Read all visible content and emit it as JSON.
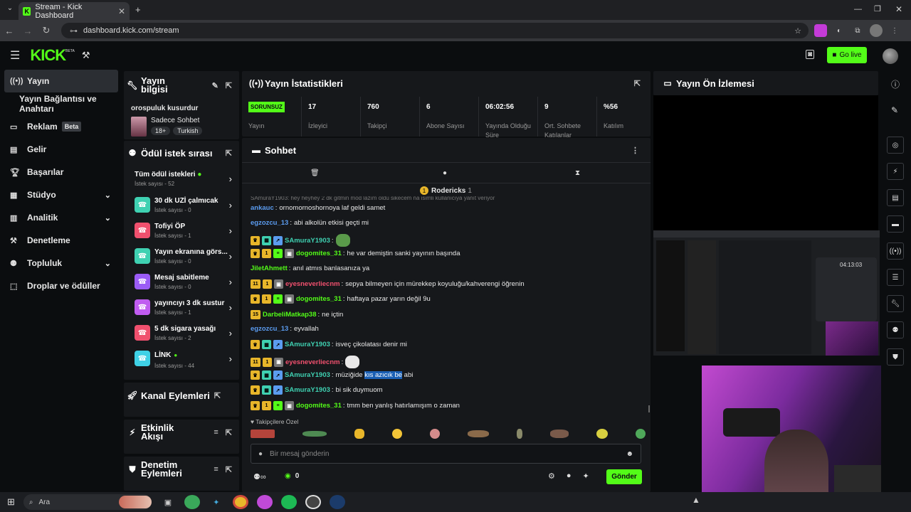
{
  "browser": {
    "tab_title": "Stream - Kick Dashboard",
    "url": "dashboard.kick.com/stream"
  },
  "app": {
    "logo": "KICK",
    "logo_beta": "BETA",
    "go_live": "Go live"
  },
  "nav": {
    "items": [
      {
        "label": "Yayın",
        "icon": "broadcast-icon"
      },
      {
        "label": "Yayın Bağlantısı ve Anahtarı"
      },
      {
        "label": "Reklam",
        "badge": "Beta",
        "icon": "ad-icon"
      },
      {
        "label": "Gelir",
        "icon": "revenue-icon"
      },
      {
        "label": "Başarılar",
        "icon": "trophy-icon"
      },
      {
        "label": "Stüdyo",
        "icon": "studio-icon"
      },
      {
        "label": "Analitik",
        "icon": "analytics-icon"
      },
      {
        "label": "Denetleme",
        "icon": "moderation-icon"
      },
      {
        "label": "Topluluk",
        "icon": "community-icon"
      },
      {
        "label": "Droplar ve ödüller",
        "icon": "drops-icon"
      }
    ]
  },
  "stream_info": {
    "title": "Yayın bilgisi",
    "stream_title": "orospuluk kusurdur",
    "category": "Sadece Sohbet",
    "tags": [
      "18+",
      "Turkish"
    ]
  },
  "rewards": {
    "title": "Ödül istek sırası",
    "all": "Tüm ödül istekleri",
    "all_count": "İstek sayısı - 52",
    "items": [
      {
        "name": "30 dk UZİ çalmıcak",
        "count": "İstek sayısı - 0",
        "color": "#3fd1b2"
      },
      {
        "name": "Tofiyi ÖP",
        "count": "İstek sayısı - 1",
        "color": "#f0506e"
      },
      {
        "name": "Yayın ekranına görs...",
        "count": "İstek sayısı - 0",
        "color": "#3fd1b2"
      },
      {
        "name": "Mesaj sabitleme",
        "count": "İstek sayısı - 0",
        "color": "#9b5cf6"
      },
      {
        "name": "yayıncıyı 3 dk sustur",
        "count": "İstek sayısı - 1",
        "color": "#c05cf0"
      },
      {
        "name": "5 dk sigara yasağı",
        "count": "İstek sayısı - 2",
        "color": "#f0506e"
      },
      {
        "name": "LİNK",
        "count": "İstek sayısı - 44",
        "color": "#3fd1e6"
      }
    ]
  },
  "channel_actions": {
    "title": "Kanal Eylemleri"
  },
  "activity": {
    "title": "Etkinlik Akışı"
  },
  "mod_actions": {
    "title": "Denetim Eylemleri"
  },
  "stats": {
    "title": "Yayın İstatistikleri",
    "items": [
      {
        "value": "SORUNSUZ",
        "label": "Yayın"
      },
      {
        "value": "17",
        "label": "İzleyici"
      },
      {
        "value": "760",
        "label": "Takipçi"
      },
      {
        "value": "6",
        "label": "Abone Sayısı"
      },
      {
        "value": "06:02:56",
        "label": "Yayında Olduğu Süre"
      },
      {
        "value": "9",
        "label": "Ort. Sohbete Katılanlar"
      },
      {
        "value": "%56",
        "label": "Katılım"
      }
    ]
  },
  "chat": {
    "title": "Sohbet",
    "pinned_user": "Rodericks",
    "pinned_count": "1",
    "faded": "SAmuraY1903: hey heyhey 2 dk gitmin mod lazım oldu sikecem na isimli kullanıcıya yanıt veriyor",
    "messages": [
      {
        "user": "ankauc",
        "color": "#5b9cf0",
        "text": "ornomornoshornoya laf geldi samet",
        "badges": []
      },
      {
        "user": "egzozcu_13",
        "color": "#5b9cf0",
        "text": "abi alkolün etkisi geçti mi",
        "badges": []
      },
      {
        "user": "SAmuraY1903",
        "color": "#3fd1b2",
        "text": "",
        "badges": [
          "crown",
          "grid",
          "arrow"
        ],
        "emote": true
      },
      {
        "user": "dogomites_31",
        "color": "#53fc18",
        "text": "he var demiştin sanki yayının başında",
        "badges": [
          "crown",
          "1",
          "green",
          "gift"
        ]
      },
      {
        "user": "JiletAhmett",
        "color": "#53fc18",
        "text": "anıl atmıs banlasanıza ya",
        "badges": []
      },
      {
        "user": "eyesneverliecnm",
        "color": "#f0506e",
        "text": "sepya bilmeyen için mürekkep koyuluğu/kahverengi öğrenin",
        "badges": [
          "11",
          "1",
          "gift"
        ]
      },
      {
        "user": "dogomites_31",
        "color": "#53fc18",
        "text": "haftaya pazar yarın değil 9u",
        "badges": [
          "crown",
          "1",
          "green",
          "gift"
        ]
      },
      {
        "user": "DarbeliMatkap38",
        "color": "#53fc18",
        "text": "ne içtin",
        "badges": [
          "15"
        ]
      },
      {
        "user": "egzozcu_13",
        "color": "#5b9cf0",
        "text": "eyvallah",
        "badges": []
      },
      {
        "user": "SAmuraY1903",
        "color": "#3fd1b2",
        "text": "isveç çikolatası denir mi",
        "badges": [
          "crown",
          "grid",
          "arrow"
        ]
      },
      {
        "user": "eyesneverliecnm",
        "color": "#f0506e",
        "text": "",
        "badges": [
          "11",
          "1",
          "gift"
        ],
        "emote": true
      },
      {
        "user": "SAmuraY1903",
        "color": "#3fd1b2",
        "text_a": "müziğide ",
        "text_hl": "kıs azıcık be",
        "text_b": " abi",
        "badges": [
          "crown",
          "grid",
          "arrow"
        ]
      },
      {
        "user": "SAmuraY1903",
        "color": "#3fd1b2",
        "text": "bi sik duymuom",
        "badges": [
          "crown",
          "grid",
          "arrow"
        ]
      },
      {
        "user": "dogomites_31",
        "color": "#53fc18",
        "text": "tmm ben yanlış hatırlamışım o zaman",
        "badges": [
          "crown",
          "1",
          "green",
          "gift"
        ]
      }
    ],
    "follower_only": "Takipçilere Özel",
    "input_placeholder": "Bir mesaj gönderin",
    "send": "Gönder",
    "viewer_count": "0"
  },
  "preview": {
    "title": "Yayın Ön İzlemesi",
    "clock": "04:13:03"
  },
  "taskbar": {
    "search": "Ara"
  }
}
